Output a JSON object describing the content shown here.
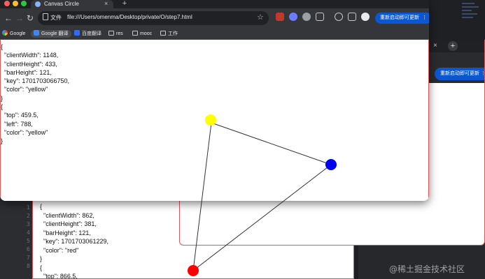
{
  "browser": {
    "tab_title": "Canvas Circle",
    "tab_close": "×",
    "new_tab": "+",
    "nav": {
      "back": "←",
      "forward": "→",
      "reload": "↻"
    },
    "omnibox": {
      "scheme_label": "文件",
      "url": "file:///Users/omenma/Desktop/private/O/step7.html",
      "star": "☆"
    },
    "update_button": "重新启动即可更新",
    "menu_dots": "⋮"
  },
  "bookmarks": [
    {
      "label": "Google",
      "icon": "google-icon"
    },
    {
      "label": "Google 翻译",
      "icon": "translate-icon"
    },
    {
      "label": "百度翻译",
      "icon": "baidu-translate-icon"
    },
    {
      "label": "res",
      "icon": "folder-icon"
    },
    {
      "label": "mooc",
      "icon": "folder-icon"
    },
    {
      "label": "工作",
      "icon": "folder-icon"
    }
  ],
  "main_output": "{\n  \"clientWidth\": 1148,\n  \"clientHeight\": 433,\n  \"barHeight\": 121,\n  \"key\": 1701703066750,\n  \"color\": \"yellow\"\n}\n{\n  \"top\": 459.5,\n  \"left\": 788,\n  \"color\": \"yellow\"\n}",
  "back_window_output": "{\n  \"clientWidth\": 862,\n  \"clientHeight\": 381,\n  \"barHeight\": 121,\n  \"key\": 1701703061229,\n  \"color\": \"red\"\n}\n{\n  \"top\": 866.5,",
  "back_window2": {
    "tab_close": "×",
    "new_tab": "+",
    "update_button": "重新启动即可更新 ⋮"
  },
  "canvas": {
    "circles": [
      {
        "name": "yellow",
        "color": "#ffff00"
      },
      {
        "name": "blue",
        "color": "#0000ee"
      },
      {
        "name": "red",
        "color": "#ff0000"
      }
    ],
    "line_color": "#333333"
  },
  "watermark": "@稀土掘金技术社区",
  "colors": {
    "accent": "#0b57d0",
    "chrome_dark": "#202124",
    "chrome_mid": "#35363a",
    "border_red": "#e05555"
  }
}
